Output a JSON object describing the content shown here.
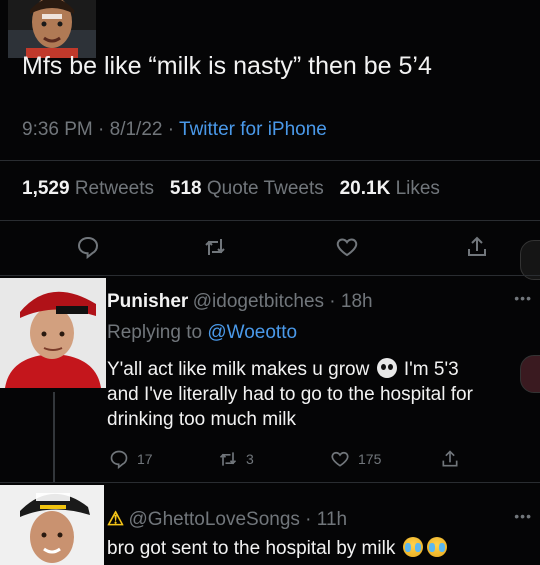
{
  "main_tweet": {
    "text": "Mfs be like “milk is nasty” then be 5’4",
    "time": "9:36 PM · 8/1/22 · ",
    "source": "Twitter for iPhone",
    "stats": {
      "retweets_count": "1,529",
      "retweets_label": "Retweets",
      "quotes_count": "518",
      "quotes_label": "Quote Tweets",
      "likes_count": "20.1K",
      "likes_label": "Likes"
    },
    "actions": [
      "reply-icon",
      "retweet-icon",
      "like-icon",
      "share-icon"
    ]
  },
  "replies": [
    {
      "name": "Punisher",
      "handle": "@idogetbitches · 18h",
      "replying_prefix": "Replying to ",
      "replying_to": "@Woeotto",
      "line1a": "Y'all act like milk makes u grow ",
      "line1b": " I'm 5'3",
      "line2": "and I've literally had to go to the hospital for",
      "line3": "drinking too much milk",
      "reply_count": "17",
      "retweet_count": "3",
      "like_count": "175"
    },
    {
      "name": "⚠",
      "handle": "@GhettoLoveSongs · 11h",
      "text": "bro got sent to the hospital by milk"
    }
  ],
  "colors": {
    "background": "#050506",
    "text": "#e7e9ea",
    "muted": "#71767b",
    "link": "#4a99e9"
  }
}
